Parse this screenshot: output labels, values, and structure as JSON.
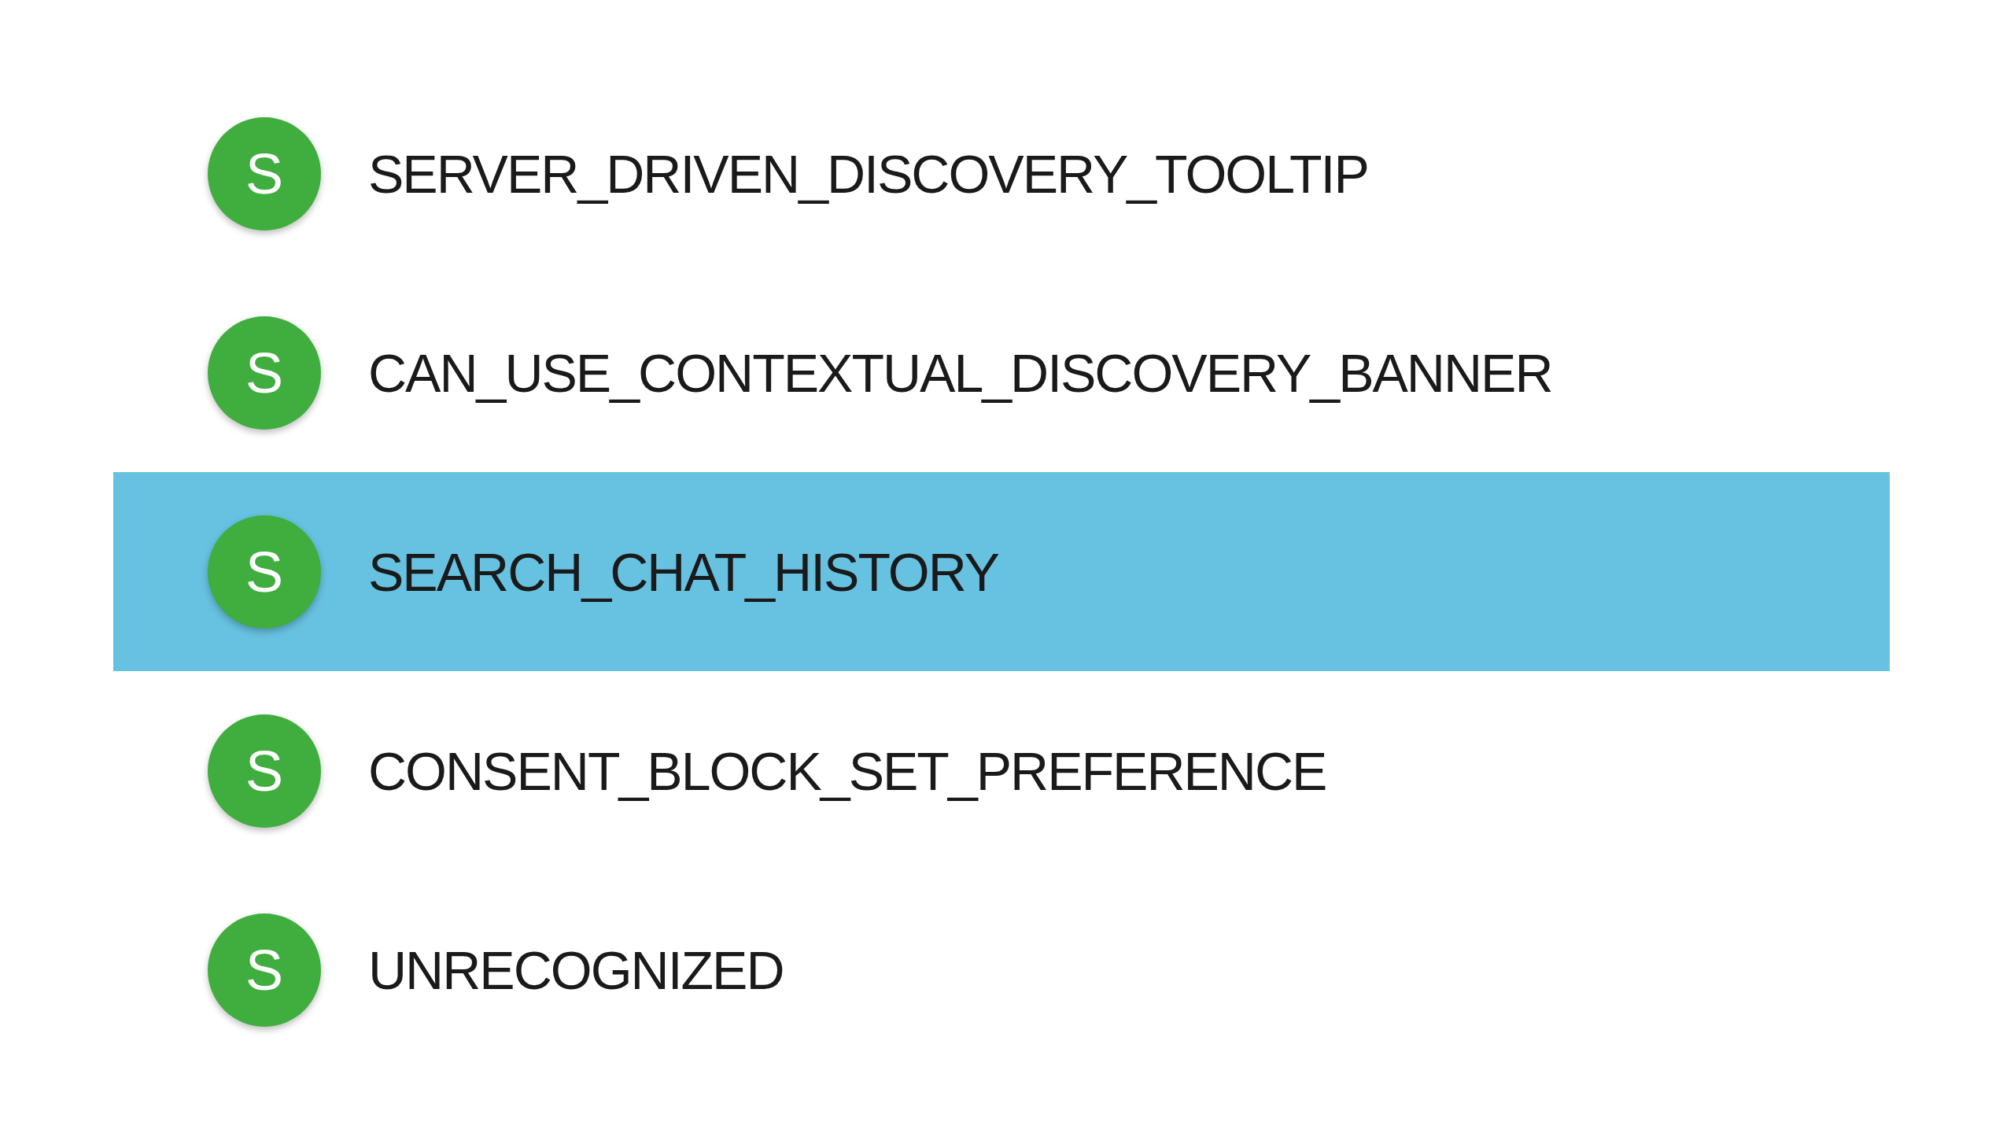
{
  "items": [
    {
      "avatar": "S",
      "label": "SERVER_DRIVEN_DISCOVERY_TOOLTIP",
      "selected": false
    },
    {
      "avatar": "S",
      "label": "CAN_USE_CONTEXTUAL_DISCOVERY_BANNER",
      "selected": false
    },
    {
      "avatar": "S",
      "label": "SEARCH_CHAT_HISTORY",
      "selected": true
    },
    {
      "avatar": "S",
      "label": "CONSENT_BLOCK_SET_PREFERENCE",
      "selected": false
    },
    {
      "avatar": "S",
      "label": "UNRECOGNIZED",
      "selected": false
    }
  ]
}
